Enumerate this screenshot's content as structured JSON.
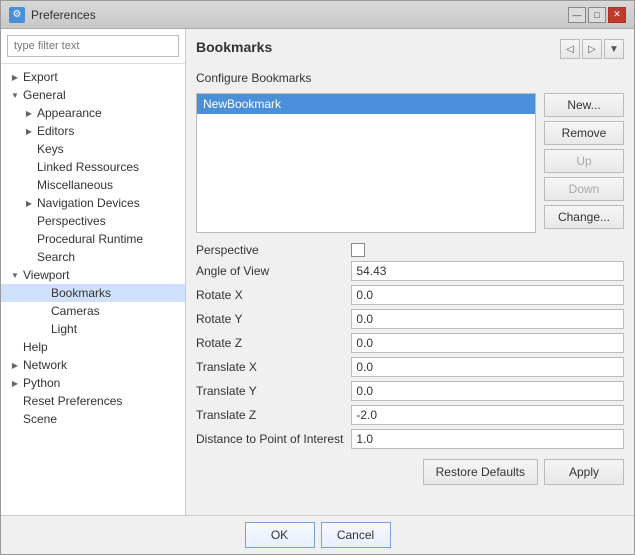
{
  "window": {
    "title": "Preferences",
    "icon": "⚙"
  },
  "titleControls": {
    "minimize": "—",
    "maximize": "□",
    "close": "✕"
  },
  "filter": {
    "placeholder": "type filter text"
  },
  "sidebar": {
    "items": [
      {
        "id": "export",
        "label": "Export",
        "indent": 1,
        "arrow": "",
        "hasArrow": true,
        "arrowRight": true
      },
      {
        "id": "general",
        "label": "General",
        "indent": 1,
        "arrow": "▼",
        "hasArrow": true,
        "expanded": true
      },
      {
        "id": "appearance",
        "label": "Appearance",
        "indent": 2,
        "arrow": "▶",
        "hasArrow": true
      },
      {
        "id": "editors",
        "label": "Editors",
        "indent": 2,
        "arrow": "▶",
        "hasArrow": true
      },
      {
        "id": "keys",
        "label": "Keys",
        "indent": 2,
        "arrow": "",
        "hasArrow": false
      },
      {
        "id": "linked-resources",
        "label": "Linked Ressources",
        "indent": 2,
        "arrow": "",
        "hasArrow": false
      },
      {
        "id": "miscellaneous",
        "label": "Miscellaneous",
        "indent": 2,
        "arrow": "",
        "hasArrow": false
      },
      {
        "id": "nav-devices",
        "label": "Navigation Devices",
        "indent": 2,
        "arrow": "▶",
        "hasArrow": true
      },
      {
        "id": "perspectives",
        "label": "Perspectives",
        "indent": 2,
        "arrow": "",
        "hasArrow": false
      },
      {
        "id": "procedural-runtime",
        "label": "Procedural Runtime",
        "indent": 2,
        "arrow": "",
        "hasArrow": false
      },
      {
        "id": "search",
        "label": "Search",
        "indent": 2,
        "arrow": "",
        "hasArrow": false
      },
      {
        "id": "viewport",
        "label": "Viewport",
        "indent": 1,
        "arrow": "▼",
        "hasArrow": true,
        "expanded": true
      },
      {
        "id": "bookmarks",
        "label": "Bookmarks",
        "indent": 3,
        "arrow": "",
        "hasArrow": false,
        "selected": true
      },
      {
        "id": "cameras",
        "label": "Cameras",
        "indent": 3,
        "arrow": "",
        "hasArrow": false
      },
      {
        "id": "light",
        "label": "Light",
        "indent": 3,
        "arrow": "",
        "hasArrow": false
      },
      {
        "id": "help",
        "label": "Help",
        "indent": 1,
        "arrow": "",
        "hasArrow": false
      },
      {
        "id": "network",
        "label": "Network",
        "indent": 1,
        "arrow": "▶",
        "hasArrow": true
      },
      {
        "id": "python",
        "label": "Python",
        "indent": 1,
        "arrow": "▶",
        "hasArrow": true
      },
      {
        "id": "reset-prefs",
        "label": "Reset Preferences",
        "indent": 1,
        "arrow": "",
        "hasArrow": false
      },
      {
        "id": "scene",
        "label": "Scene",
        "indent": 1,
        "arrow": "",
        "hasArrow": false
      }
    ]
  },
  "panel": {
    "title": "Bookmarks",
    "configureLabel": "Configure Bookmarks",
    "bookmarksList": [
      {
        "id": "new-bookmark",
        "label": "NewBookmark",
        "selected": true
      }
    ],
    "buttons": {
      "new": "New...",
      "remove": "Remove",
      "up": "Up",
      "down": "Down",
      "change": "Change..."
    },
    "properties": [
      {
        "id": "perspective",
        "label": "Perspective",
        "type": "checkbox",
        "value": ""
      },
      {
        "id": "angle-of-view",
        "label": "Angle of View",
        "type": "text",
        "value": "54.43"
      },
      {
        "id": "rotate-x",
        "label": "Rotate X",
        "type": "text",
        "value": "0.0"
      },
      {
        "id": "rotate-y",
        "label": "Rotate Y",
        "type": "text",
        "value": "0.0"
      },
      {
        "id": "rotate-z",
        "label": "Rotate Z",
        "type": "text",
        "value": "0.0"
      },
      {
        "id": "translate-x",
        "label": "Translate X",
        "type": "text",
        "value": "0.0"
      },
      {
        "id": "translate-y",
        "label": "Translate Y",
        "type": "text",
        "value": "0.0"
      },
      {
        "id": "translate-z",
        "label": "Translate Z",
        "type": "text",
        "value": "-2.0"
      },
      {
        "id": "dist-to-poi",
        "label": "Distance to Point of Interest",
        "type": "text",
        "value": "1.0"
      }
    ],
    "bottomButtons": {
      "restoreDefaults": "Restore Defaults",
      "apply": "Apply"
    }
  },
  "footer": {
    "ok": "OK",
    "cancel": "Cancel"
  }
}
